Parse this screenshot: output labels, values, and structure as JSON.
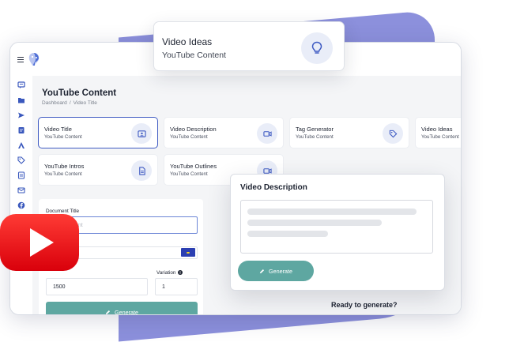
{
  "page": {
    "title": "YouTube Content",
    "breadcrumb": [
      "Dashboard",
      "Video Title"
    ],
    "breadcrumb_separator": "/"
  },
  "tools": [
    {
      "title": "Video Title",
      "subtitle": "YouTube Content",
      "icon": "video-badge-icon",
      "active": true
    },
    {
      "title": "Video Description",
      "subtitle": "YouTube Content",
      "icon": "video-camera-icon",
      "active": false
    },
    {
      "title": "Tag Generator",
      "subtitle": "YouTube Content",
      "icon": "tag-icon",
      "active": false
    },
    {
      "title": "Video Ideas",
      "subtitle": "YouTube Content",
      "icon": "lightbulb-icon",
      "active": false
    },
    {
      "title": "YouTube Intros",
      "subtitle": "YouTube Content",
      "icon": "document-icon",
      "active": false
    },
    {
      "title": "YouTube Outlines",
      "subtitle": "YouTube Content",
      "icon": "video-camera-icon",
      "active": false
    }
  ],
  "form": {
    "document_title_label": "Document Title",
    "document_title_placeholder": "...Document",
    "tokens_value": "1500",
    "variation_label": "Variation",
    "variation_value": "1",
    "generate_label": "Generate"
  },
  "ideas_card": {
    "title": "Video Ideas",
    "subtitle": "YouTube Content",
    "icon": "lightbulb-icon"
  },
  "desc_card": {
    "title": "Video Description",
    "generate_label": "Generate"
  },
  "ready_text": "Ready to generate?",
  "sidebar_icons": [
    "chat-icon",
    "folder-icon",
    "send-icon",
    "edit-document-icon",
    "a-letter-icon",
    "tag-icon",
    "document-list-icon",
    "mail-icon",
    "facebook-icon"
  ],
  "colors": {
    "accent_blue": "#3e5ac2",
    "generate_teal": "#5ea7a1",
    "blob_purple": "#8c90dc",
    "youtube_red": "#f0131e",
    "icon_bubble": "#e9edf8"
  }
}
